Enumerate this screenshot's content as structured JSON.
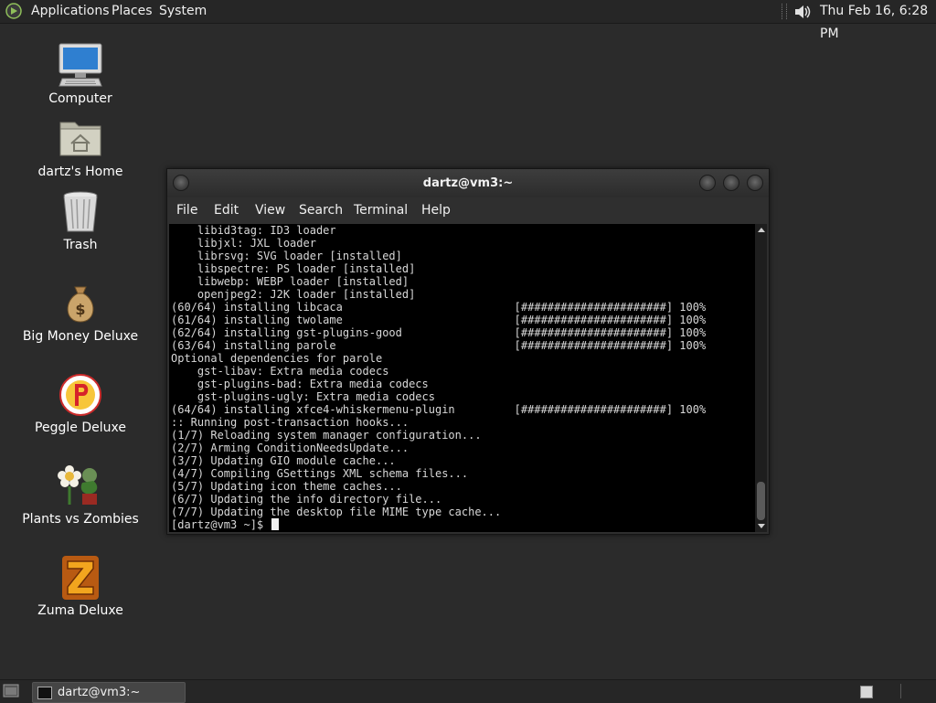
{
  "top_panel": {
    "menus": [
      "Applications",
      "Places",
      "System"
    ],
    "clock": "Thu Feb 16,  6:28 PM",
    "icons": [
      "distro-logo-icon",
      "volume-speaker-icon"
    ]
  },
  "desktop_icons": [
    {
      "label": "Computer",
      "icon": "computer-monitor-icon"
    },
    {
      "label": "dartz's Home",
      "icon": "home-folder-icon"
    },
    {
      "label": "Trash",
      "icon": "trash-bin-icon"
    },
    {
      "label": "Big Money Deluxe",
      "icon": "money-bag-icon"
    },
    {
      "label": "Peggle Deluxe",
      "icon": "peggle-ball-icon"
    },
    {
      "label": "Plants vs Zombies",
      "icon": "flower-zombie-icon"
    },
    {
      "label": "Zuma Deluxe",
      "icon": "zuma-z-icon"
    }
  ],
  "terminal": {
    "title": "dartz@vm3:~",
    "menu": [
      "File",
      "Edit",
      "View",
      "Search",
      "Terminal",
      "Help"
    ],
    "lines": [
      "    libid3tag: ID3 loader",
      "    libjxl: JXL loader",
      "    librsvg: SVG loader [installed]",
      "    libspectre: PS loader [installed]",
      "    libwebp: WEBP loader [installed]",
      "    openjpeg2: J2K loader [installed]",
      "(60/64) installing libcaca                          [######################] 100%",
      "(61/64) installing twolame                          [######################] 100%",
      "(62/64) installing gst-plugins-good                 [######################] 100%",
      "(63/64) installing parole                           [######################] 100%",
      "Optional dependencies for parole",
      "    gst-libav: Extra media codecs",
      "    gst-plugins-bad: Extra media codecs",
      "    gst-plugins-ugly: Extra media codecs",
      "(64/64) installing xfce4-whiskermenu-plugin         [######################] 100%",
      ":: Running post-transaction hooks...",
      "(1/7) Reloading system manager configuration...",
      "(2/7) Arming ConditionNeedsUpdate...",
      "(3/7) Updating GIO module cache...",
      "(4/7) Compiling GSettings XML schema files...",
      "(5/7) Updating icon theme caches...",
      "(6/7) Updating the info directory file...",
      "(7/7) Updating the desktop file MIME type cache..."
    ],
    "prompt": "[dartz@vm3 ~]$ "
  },
  "taskbar": {
    "task_label": "dartz@vm3:~",
    "icons": [
      "show-desktop-icon",
      "terminal-icon",
      "workspace-switcher-icon"
    ]
  },
  "colors": {
    "desktop": "#2b2b2b",
    "panel": "#262626",
    "terminal_bg": "#000000",
    "terminal_fg": "#d8d8d8"
  }
}
